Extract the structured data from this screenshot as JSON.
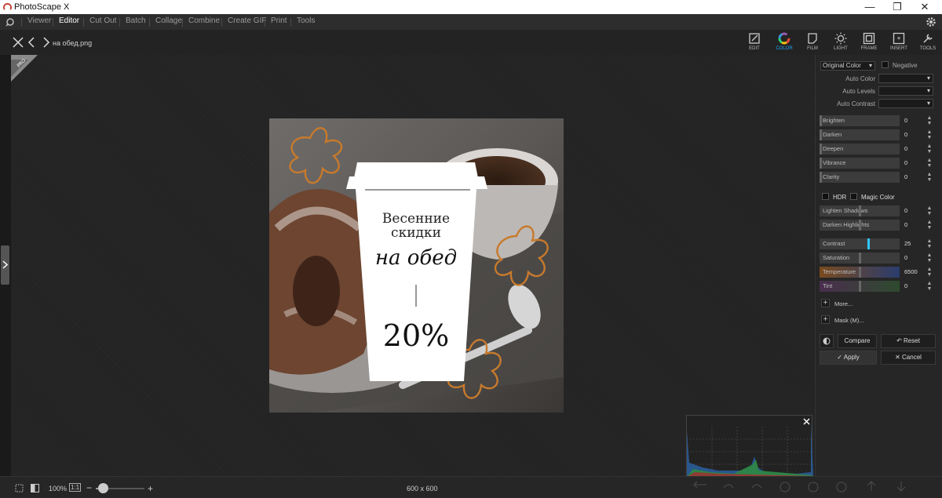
{
  "app": {
    "title": "PhotoScape X"
  },
  "menu": {
    "items": [
      "Viewer",
      "Editor",
      "Cut Out",
      "Batch",
      "Collage",
      "Combine",
      "Create GIF",
      "Print",
      "Tools"
    ],
    "active": "Editor"
  },
  "file": {
    "name": "на обед.png"
  },
  "tabs": [
    {
      "label": "EDIT"
    },
    {
      "label": "COLOR"
    },
    {
      "label": "FILM"
    },
    {
      "label": "LIGHT"
    },
    {
      "label": "FRAME"
    },
    {
      "label": "INSERT"
    },
    {
      "label": "TOOLS"
    }
  ],
  "badge": {
    "text": "PRO"
  },
  "image": {
    "heading_line1": "Весенние",
    "heading_line2": "скидки",
    "script": "на обед",
    "discount": "20%"
  },
  "panel": {
    "color_mode": "Original Color",
    "negative_label": "Negative",
    "auto_color": "Auto Color",
    "auto_levels": "Auto Levels",
    "auto_contrast": "Auto Contrast",
    "sliders1": [
      {
        "label": "Brighten",
        "value": "0"
      },
      {
        "label": "Darken",
        "value": "0"
      },
      {
        "label": "Deepen",
        "value": "0"
      },
      {
        "label": "Vibrance",
        "value": "0"
      },
      {
        "label": "Clarity",
        "value": "0"
      }
    ],
    "hdr_label": "HDR",
    "magic_label": "Magic Color",
    "sliders2": [
      {
        "label": "Lighten Shadows",
        "value": "0"
      },
      {
        "label": "Darken Highlights",
        "value": "0"
      }
    ],
    "sliders3": [
      {
        "label": "Contrast",
        "value": "25"
      },
      {
        "label": "Saturation",
        "value": "0"
      },
      {
        "label": "Temperature",
        "value": "6500"
      },
      {
        "label": "Tint",
        "value": "0"
      }
    ],
    "more_label": "More...",
    "mask_label": "Mask (M)...",
    "compare_label": "Compare",
    "reset_label": "Reset",
    "apply_label": "Apply",
    "cancel_label": "Cancel"
  },
  "bottom": {
    "zoom": "100%",
    "one_to_one": "1:1",
    "dimensions": "600 x 600",
    "zoom_level": 0.15
  },
  "colors": {
    "accent": "#19a6ff",
    "contrast_knob": "#2ec8ff",
    "doodle": "#c77a2c"
  }
}
